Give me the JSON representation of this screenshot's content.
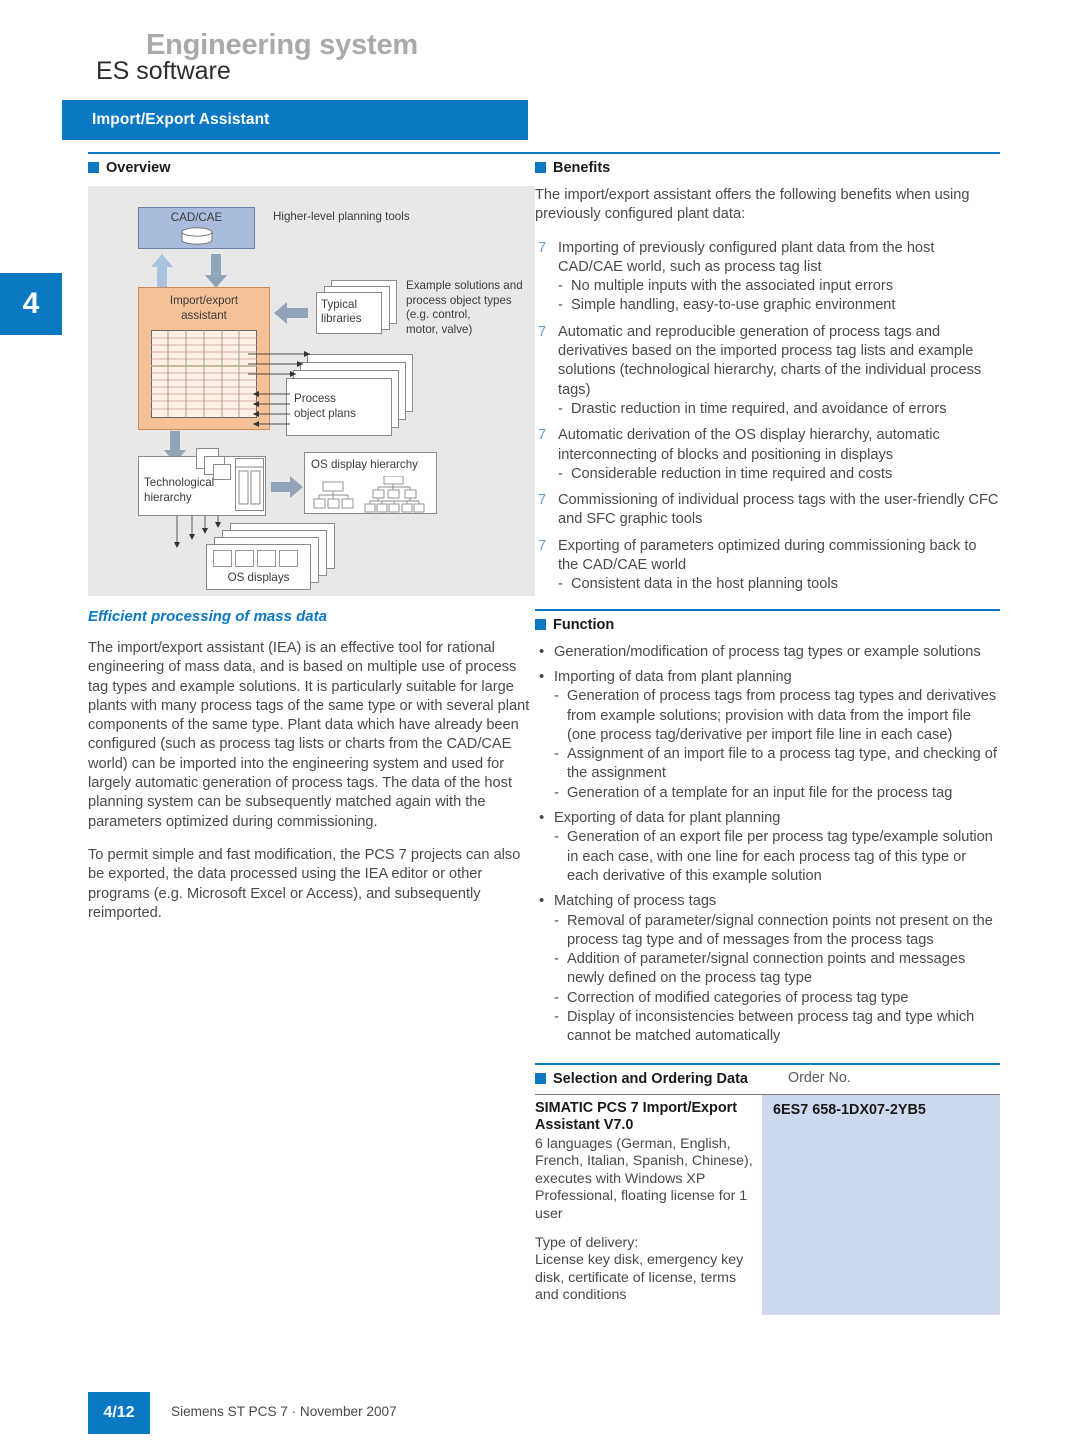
{
  "header": {
    "system": "Engineering system",
    "subtitle": "ES software",
    "title": "Import/Export Assistant",
    "chapter": "4"
  },
  "colors": {
    "brand_blue": "#0a78c2",
    "accent_grey": "#a9aaac",
    "table_fill": "#ccd9ee",
    "diagram_bg": "#e8e8e8",
    "diagram_orange": "#f5c196",
    "diagram_blue": "#aabcdd"
  },
  "left": {
    "overview_label": "Overview",
    "diagram": {
      "cad_cae": "CAD/CAE",
      "higher_level": "Higher-level planning tools",
      "import_export_assistant": "Import/export\nassistant",
      "typical_libraries": "Typical\nlibraries",
      "example_solutions": "Example solutions and\nprocess object types\n(e.g. control,\nmotor, valve)",
      "process_object_plans": "Process\nobject plans",
      "technological_hierarchy": "Technological\nhierarchy",
      "os_display_hierarchy": "OS display hierarchy",
      "os_displays": "OS displays"
    },
    "subhead": "Efficient processing of mass data",
    "paragraphs": [
      "The import/export assistant (IEA) is an effective tool for rational engineering of mass data, and is based on multiple use of process tag types and example solutions. It is particularly suitable for large plants with many process tags of the same type or with several plant components of the same type. Plant data which have already been configured (such as process tag lists or charts from the CAD/CAE world) can be imported into the engineering system and used for largely automatic generation of process tags. The data of the host planning system can be subsequently matched again with the parameters optimized during commissioning.",
      "To permit simple and fast modification, the PCS 7 projects can also be exported, the data processed using the IEA editor or other programs (e.g. Microsoft Excel or Access), and subsequently reimported."
    ]
  },
  "right": {
    "benefits_label": "Benefits",
    "benefits_intro": "The import/export assistant offers the following benefits when using previously configured plant data:",
    "benefits": [
      {
        "marker": "7",
        "text": "Importing of previously configured plant data from the host CAD/CAE world, such as process tag list",
        "sub": [
          "No multiple inputs with the associated input errors",
          "Simple handling, easy-to-use graphic environment"
        ]
      },
      {
        "marker": "7",
        "text": "Automatic and reproducible generation of process tags and derivatives based on the imported process tag lists and example solutions (technological hierarchy, charts of the individual process tags)",
        "sub": [
          "Drastic reduction in time required, and avoidance of errors"
        ]
      },
      {
        "marker": "7",
        "text": "Automatic derivation of the OS display hierarchy, automatic interconnecting of blocks and positioning in displays",
        "sub": [
          "Considerable reduction in time required and costs"
        ]
      },
      {
        "marker": "7",
        "text": "Commissioning of individual process tags with the user-friendly CFC and SFC graphic tools",
        "sub": []
      },
      {
        "marker": "7",
        "text": "Exporting of parameters optimized during commissioning back to the CAD/CAE world",
        "sub": [
          "Consistent data in the host planning tools"
        ]
      }
    ],
    "function_label": "Function",
    "functions": [
      {
        "marker": "•",
        "text": "Generation/modification of process tag types or example solutions",
        "sub": []
      },
      {
        "marker": "•",
        "text": "Importing of data from plant planning",
        "sub": [
          "Generation of process tags from process tag types and derivatives from example solutions; provision with data from the import file (one process tag/derivative per import file line in each case)",
          "Assignment of an import file to a process tag type, and checking of the assignment",
          "Generation of a template for an input file for the process tag"
        ]
      },
      {
        "marker": "•",
        "text": "Exporting of data for plant planning",
        "sub": [
          "Generation of an export file per process tag type/example solution in each case, with one line for each process tag of this type or each derivative of this example solution"
        ]
      },
      {
        "marker": "•",
        "text": "Matching of process tags",
        "sub": [
          "Removal of parameter/signal connection points not present on the process tag type and of messages from the process tags",
          "Addition of parameter/signal connection points and messages newly defined on the process tag type",
          "Correction of modified categories of process tag type",
          "Display of inconsistencies between process tag and type which cannot be matched automatically"
        ]
      }
    ],
    "ordering": {
      "label": "Selection and Ordering Data",
      "order_no_header": "Order No.",
      "product_title": "SIMATIC PCS 7 Import/Export Assistant V7.0",
      "product_desc": "6 languages (German, English, French, Italian, Spanish, Chinese), executes with Windows XP Professional, floating license for 1 user",
      "delivery_desc": "Type of delivery:\nLicense key disk, emergency key disk, certificate of license, terms and conditions",
      "order_no": "6ES7 658-1DX07-2YB5"
    }
  },
  "footer": {
    "page": "4/12",
    "text": "Siemens ST PCS 7 · November 2007"
  }
}
